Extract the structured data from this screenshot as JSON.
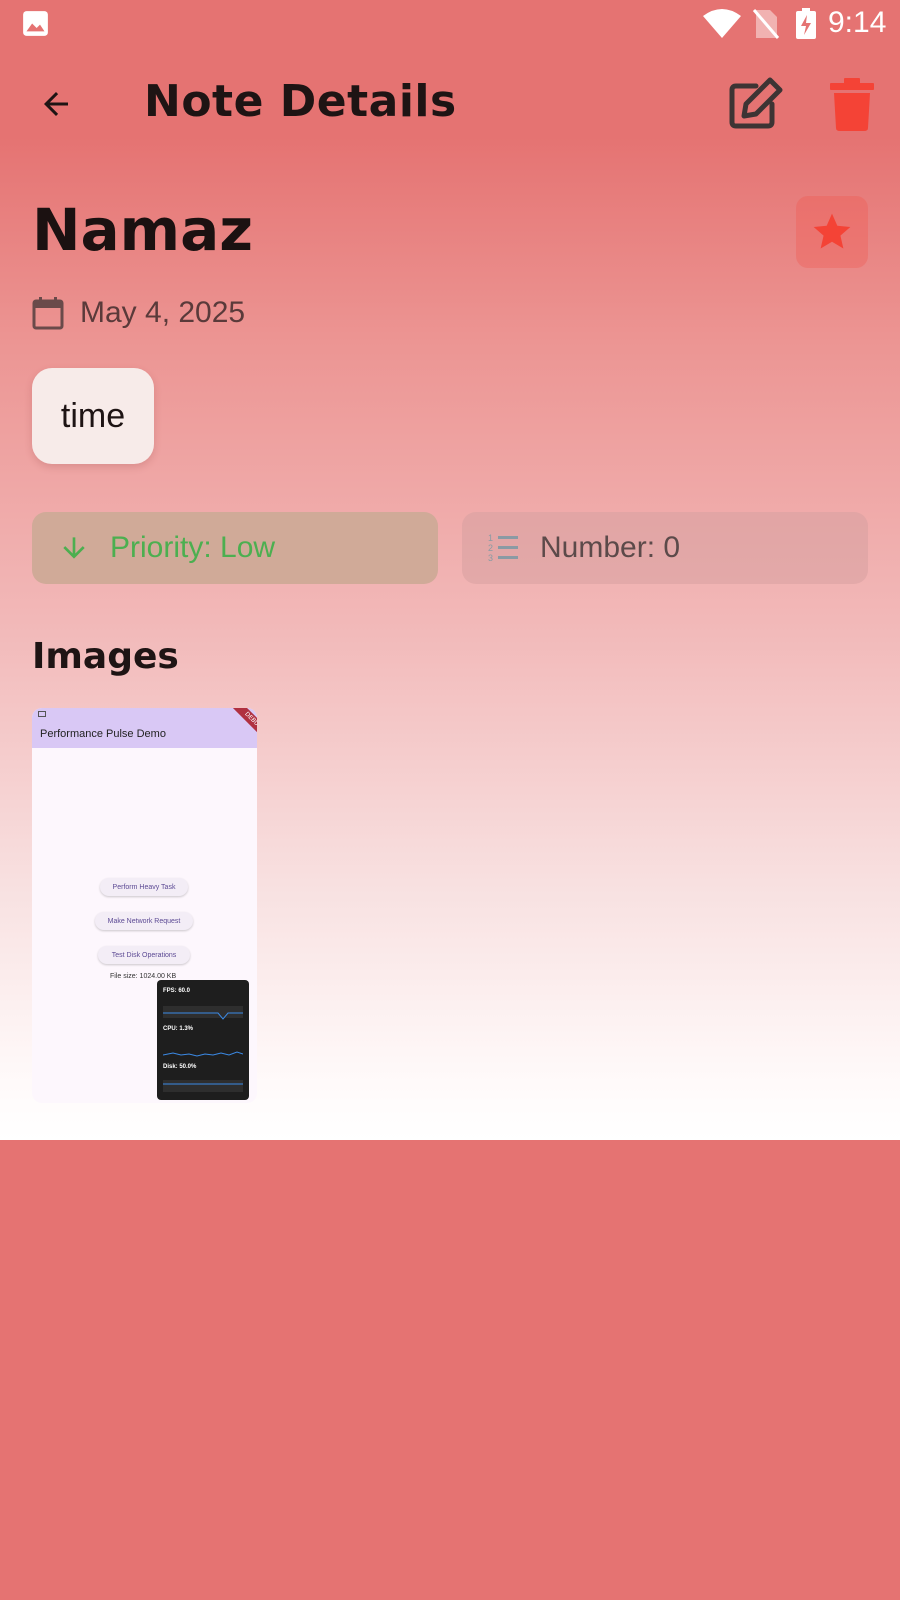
{
  "status_bar": {
    "time": "9:14"
  },
  "app_bar": {
    "title": "Note Details",
    "back_icon": "arrow-back-icon",
    "edit_icon": "edit-icon",
    "delete_icon": "trash-icon"
  },
  "note": {
    "title": "Namaz",
    "favorite_icon": "star-icon",
    "date": "May 4, 2025",
    "tag": "time",
    "priority": "Priority: Low",
    "number": "Number: 0"
  },
  "images_section": {
    "title": "Images",
    "thumbnail": {
      "app_title": "Performance Pulse Demo",
      "ribbon": "DEBUG",
      "buttons": [
        "Perform Heavy Task",
        "Make Network Request",
        "Test Disk Operations"
      ],
      "file_size": "File size: 1024.00 KB",
      "metrics": [
        "FPS: 60.0",
        "CPU: 1.3%",
        "Disk: 50.0%"
      ]
    }
  },
  "colors": {
    "accent_red": "#f44336",
    "priority_green": "#4caf50",
    "background": "#e57372"
  }
}
